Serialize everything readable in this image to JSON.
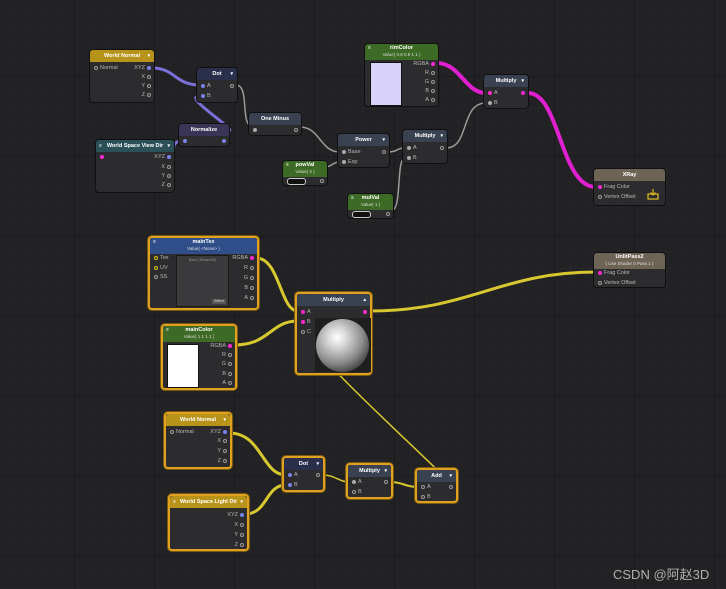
{
  "nodes": {
    "world_normal_top": {
      "title": "World Normal",
      "out_label": "Normal",
      "ports": [
        "XYZ",
        "X",
        "Y",
        "Z"
      ]
    },
    "dot_top": {
      "title": "Dot",
      "ports": [
        "A",
        "B"
      ]
    },
    "normalize": {
      "title": "Normalize"
    },
    "world_view_dir": {
      "title": "World Space View Dir",
      "ports": [
        "XYZ",
        "X",
        "Y",
        "Z"
      ]
    },
    "one_minus": {
      "title": "One Minus"
    },
    "rim_color": {
      "title": "rimColor",
      "subtitle": "Value( 0.8 0.8 1 1 )",
      "ports": [
        "RGBA",
        "R",
        "G",
        "B",
        "A"
      ],
      "swatch_color": "#d8d2f8"
    },
    "multiply_top": {
      "title": "Multiply",
      "ports": [
        "A",
        "B"
      ]
    },
    "power": {
      "title": "Power",
      "ports": [
        "Base",
        "Exp"
      ]
    },
    "multiply_mid": {
      "title": "Multiply",
      "ports": [
        "A",
        "B"
      ]
    },
    "pow_val": {
      "title": "powVal",
      "subtitle": "Value( 2 )"
    },
    "mul_val": {
      "title": "mulVal",
      "subtitle": "Value( 1 )"
    },
    "xray": {
      "title": "XRay",
      "ports": [
        "Frag Color",
        "Vertex Offset"
      ]
    },
    "main_tex": {
      "title": "mainTex",
      "subtitle": "Value( <None> )",
      "ports_in": [
        "Tex",
        "UV",
        "SS"
      ],
      "ports_out": [
        "RGBA",
        "R",
        "G",
        "B",
        "A"
      ],
      "preview_caption": "None (Texture2D)",
      "select_label": "Select"
    },
    "main_color": {
      "title": "mainColor",
      "subtitle": "Value( 1 1 1 1 )",
      "ports": [
        "RGBA",
        "R",
        "G",
        "B",
        "A"
      ],
      "swatch_color": "#ffffff"
    },
    "multiply_main": {
      "title": "Multiply",
      "ports": [
        "A",
        "B",
        "C"
      ]
    },
    "unlit_pass2": {
      "title": "UnlitPass2",
      "subtitle": "( Use Shader 0 Pass 1 )",
      "ports": [
        "Frag Color",
        "Vertex Offset"
      ]
    },
    "world_normal_bot": {
      "title": "World Normal",
      "out_label": "Normal",
      "ports": [
        "XYZ",
        "X",
        "Y",
        "Z"
      ]
    },
    "dot_bot": {
      "title": "Dot",
      "ports": [
        "A",
        "B"
      ]
    },
    "multiply_bot": {
      "title": "Multiply",
      "ports": [
        "A",
        "B"
      ]
    },
    "add": {
      "title": "Add",
      "ports": [
        "A",
        "B"
      ]
    },
    "world_light_dir": {
      "title": "World Space Light Dir",
      "ports": [
        "XYZ",
        "X",
        "Y",
        "Z"
      ]
    }
  },
  "watermark": "CSDN @阿赵3D",
  "colors": {
    "selection": "#e0a020",
    "wire_magenta": "#e020d0",
    "wire_purple": "#7a70d8",
    "wire_gray": "#9a9a9a",
    "wire_yellow": "#e0d040"
  }
}
